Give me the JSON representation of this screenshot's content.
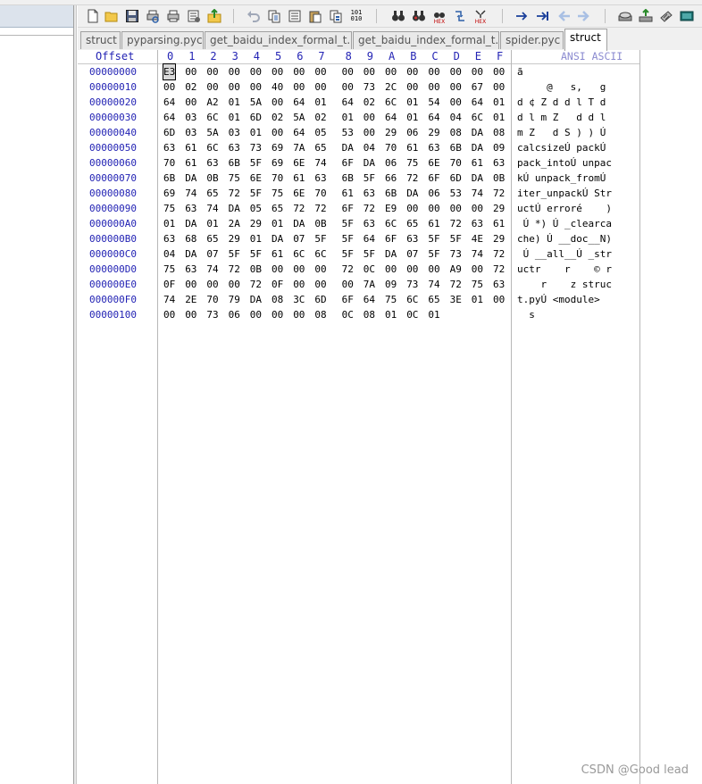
{
  "toolbar": {
    "icons": [
      "new-file-icon",
      "open-folder-icon",
      "save-icon",
      "print-preview-icon",
      "print-icon",
      "properties-icon",
      "export-icon",
      "undo-icon",
      "copy-icon",
      "copy-hex-icon",
      "paste-icon",
      "paste-special-icon",
      "hex-convert-icon",
      "find-icon",
      "find-next-icon",
      "find-hex-icon",
      "replace-icon",
      "replace-hex-icon",
      "goto-offset-icon",
      "goto-sector-icon",
      "back-arrow-icon",
      "forward-arrow-icon",
      "disk-icon",
      "disk-plus-icon",
      "ram-icon",
      "calculator-icon"
    ],
    "labels": {
      "find_hex": "HEX",
      "replace_hex": "HEX",
      "hex_convert": "101 010"
    }
  },
  "tabs": [
    {
      "label": "struct",
      "active": false
    },
    {
      "label": "pyparsing.pyc",
      "active": false
    },
    {
      "label": "get_baidu_index_formal_t...",
      "active": false
    },
    {
      "label": "get_baidu_index_formal_t...",
      "active": false
    },
    {
      "label": "spider.pyc",
      "active": false
    },
    {
      "label": "struct",
      "active": true
    }
  ],
  "hex_header": {
    "offset_label": "Offset",
    "columns": [
      "0",
      "1",
      "2",
      "3",
      "4",
      "5",
      "6",
      "7",
      "8",
      "9",
      "A",
      "B",
      "C",
      "D",
      "E",
      "F"
    ],
    "ascii_label": "ANSI ASCII"
  },
  "rows": [
    {
      "offset": "00000000",
      "bytes": [
        "E3",
        "00",
        "00",
        "00",
        "00",
        "00",
        "00",
        "00",
        "00",
        "00",
        "00",
        "00",
        "00",
        "00",
        "00",
        "00"
      ],
      "ascii": "ã"
    },
    {
      "offset": "00000010",
      "bytes": [
        "00",
        "02",
        "00",
        "00",
        "00",
        "40",
        "00",
        "00",
        "00",
        "73",
        "2C",
        "00",
        "00",
        "00",
        "67",
        "00"
      ],
      "ascii": "     @   s,   g"
    },
    {
      "offset": "00000020",
      "bytes": [
        "64",
        "00",
        "A2",
        "01",
        "5A",
        "00",
        "64",
        "01",
        "64",
        "02",
        "6C",
        "01",
        "54",
        "00",
        "64",
        "01"
      ],
      "ascii": "d ¢ Z d d l T d"
    },
    {
      "offset": "00000030",
      "bytes": [
        "64",
        "03",
        "6C",
        "01",
        "6D",
        "02",
        "5A",
        "02",
        "01",
        "00",
        "64",
        "01",
        "64",
        "04",
        "6C",
        "01"
      ],
      "ascii": "d l m Z   d d l"
    },
    {
      "offset": "00000040",
      "bytes": [
        "6D",
        "03",
        "5A",
        "03",
        "01",
        "00",
        "64",
        "05",
        "53",
        "00",
        "29",
        "06",
        "29",
        "08",
        "DA",
        "08"
      ],
      "ascii": "m Z   d S ) ) Ú"
    },
    {
      "offset": "00000050",
      "bytes": [
        "63",
        "61",
        "6C",
        "63",
        "73",
        "69",
        "7A",
        "65",
        "DA",
        "04",
        "70",
        "61",
        "63",
        "6B",
        "DA",
        "09"
      ],
      "ascii": "calcsizeÚ packÚ"
    },
    {
      "offset": "00000060",
      "bytes": [
        "70",
        "61",
        "63",
        "6B",
        "5F",
        "69",
        "6E",
        "74",
        "6F",
        "DA",
        "06",
        "75",
        "6E",
        "70",
        "61",
        "63"
      ],
      "ascii": "pack_intoÚ unpac"
    },
    {
      "offset": "00000070",
      "bytes": [
        "6B",
        "DA",
        "0B",
        "75",
        "6E",
        "70",
        "61",
        "63",
        "6B",
        "5F",
        "66",
        "72",
        "6F",
        "6D",
        "DA",
        "0B"
      ],
      "ascii": "kÚ unpack_fromÚ"
    },
    {
      "offset": "00000080",
      "bytes": [
        "69",
        "74",
        "65",
        "72",
        "5F",
        "75",
        "6E",
        "70",
        "61",
        "63",
        "6B",
        "DA",
        "06",
        "53",
        "74",
        "72"
      ],
      "ascii": "iter_unpackÚ Str"
    },
    {
      "offset": "00000090",
      "bytes": [
        "75",
        "63",
        "74",
        "DA",
        "05",
        "65",
        "72",
        "72",
        "6F",
        "72",
        "E9",
        "00",
        "00",
        "00",
        "00",
        "29"
      ],
      "ascii": "uctÚ erroré    )"
    },
    {
      "offset": "000000A0",
      "bytes": [
        "01",
        "DA",
        "01",
        "2A",
        "29",
        "01",
        "DA",
        "0B",
        "5F",
        "63",
        "6C",
        "65",
        "61",
        "72",
        "63",
        "61"
      ],
      "ascii": " Ú *) Ú _clearca"
    },
    {
      "offset": "000000B0",
      "bytes": [
        "63",
        "68",
        "65",
        "29",
        "01",
        "DA",
        "07",
        "5F",
        "5F",
        "64",
        "6F",
        "63",
        "5F",
        "5F",
        "4E",
        "29"
      ],
      "ascii": "che) Ú __doc__N)"
    },
    {
      "offset": "000000C0",
      "bytes": [
        "04",
        "DA",
        "07",
        "5F",
        "5F",
        "61",
        "6C",
        "6C",
        "5F",
        "5F",
        "DA",
        "07",
        "5F",
        "73",
        "74",
        "72"
      ],
      "ascii": " Ú __all__Ú _str"
    },
    {
      "offset": "000000D0",
      "bytes": [
        "75",
        "63",
        "74",
        "72",
        "0B",
        "00",
        "00",
        "00",
        "72",
        "0C",
        "00",
        "00",
        "00",
        "A9",
        "00",
        "72"
      ],
      "ascii": "uctr    r    © r"
    },
    {
      "offset": "000000E0",
      "bytes": [
        "0F",
        "00",
        "00",
        "00",
        "72",
        "0F",
        "00",
        "00",
        "00",
        "7A",
        "09",
        "73",
        "74",
        "72",
        "75",
        "63"
      ],
      "ascii": "    r    z struc"
    },
    {
      "offset": "000000F0",
      "bytes": [
        "74",
        "2E",
        "70",
        "79",
        "DA",
        "08",
        "3C",
        "6D",
        "6F",
        "64",
        "75",
        "6C",
        "65",
        "3E",
        "01",
        "00"
      ],
      "ascii": "t.pyÚ <module>"
    },
    {
      "offset": "00000100",
      "bytes": [
        "00",
        "00",
        "73",
        "06",
        "00",
        "00",
        "00",
        "08",
        "0C",
        "08",
        "01",
        "0C",
        "01"
      ],
      "ascii": "  s"
    }
  ],
  "watermark": "CSDN @Good lead"
}
